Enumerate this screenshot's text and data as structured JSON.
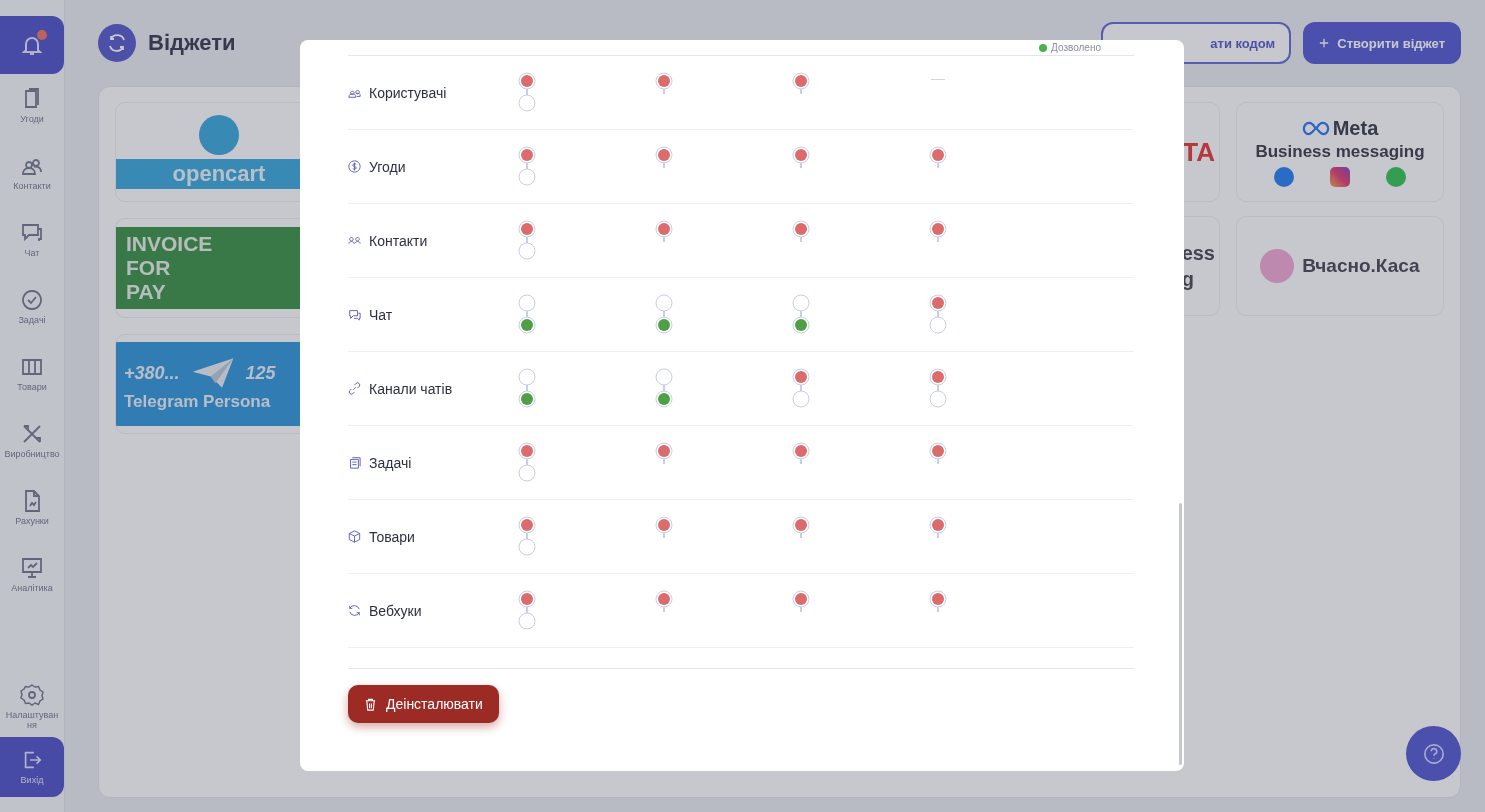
{
  "sidebar": {
    "items": [
      {
        "label": "Угоди"
      },
      {
        "label": "Контакти"
      },
      {
        "label": "Чат"
      },
      {
        "label": "Задачі"
      },
      {
        "label": "Товари"
      },
      {
        "label": "Виробництво"
      },
      {
        "label": "Рахунки"
      },
      {
        "label": "Аналітика"
      }
    ],
    "settings": "Налаштування",
    "logout": "Вихід"
  },
  "header": {
    "title": "Віджети",
    "code_button": "ати кодом",
    "create_button": "Створити віджет"
  },
  "widgets_left": [
    {
      "kind": "opencart",
      "texts": [
        "opencart"
      ]
    },
    {
      "kind": "invoice",
      "texts": [
        "INVOICE",
        "FOR",
        "PAY"
      ]
    },
    {
      "kind": "telegram",
      "texts": [
        "+380...",
        "125",
        "Telegram Persona"
      ]
    }
  ],
  "widgets_right": [
    {
      "kind": "partial_red",
      "texts": [
        "TA"
      ]
    },
    {
      "kind": "partial_dark",
      "texts": [
        "ess",
        "g"
      ]
    },
    {
      "kind": "meta",
      "texts": [
        "Meta",
        "Business messaging"
      ]
    },
    {
      "kind": "vchasno",
      "texts": [
        "Вчасно.Каса"
      ]
    }
  ],
  "modal": {
    "legend": "Дозволено",
    "rows": [
      {
        "label": "Користувачі",
        "cells": [
          {
            "kind": "toggle",
            "allowed": false,
            "expanded": true
          },
          {
            "kind": "toggle",
            "allowed": false,
            "expanded": false
          },
          {
            "kind": "toggle",
            "allowed": false,
            "expanded": false
          },
          {
            "kind": "none"
          }
        ]
      },
      {
        "label": "Угоди",
        "cells": [
          {
            "kind": "toggle",
            "allowed": false,
            "expanded": true
          },
          {
            "kind": "toggle",
            "allowed": false,
            "expanded": false
          },
          {
            "kind": "toggle",
            "allowed": false,
            "expanded": false
          },
          {
            "kind": "toggle",
            "allowed": false,
            "expanded": false
          }
        ]
      },
      {
        "label": "Контакти",
        "cells": [
          {
            "kind": "toggle",
            "allowed": false,
            "expanded": true
          },
          {
            "kind": "toggle",
            "allowed": false,
            "expanded": false
          },
          {
            "kind": "toggle",
            "allowed": false,
            "expanded": false
          },
          {
            "kind": "toggle",
            "allowed": false,
            "expanded": false
          }
        ]
      },
      {
        "label": "Чат",
        "cells": [
          {
            "kind": "toggle",
            "allowed": true,
            "expanded": true
          },
          {
            "kind": "toggle",
            "allowed": true,
            "expanded": true
          },
          {
            "kind": "toggle",
            "allowed": true,
            "expanded": true
          },
          {
            "kind": "toggle",
            "allowed": false,
            "expanded": true
          }
        ]
      },
      {
        "label": "Канали чатів",
        "cells": [
          {
            "kind": "toggle",
            "allowed": true,
            "expanded": true
          },
          {
            "kind": "toggle",
            "allowed": true,
            "expanded": true
          },
          {
            "kind": "toggle",
            "allowed": false,
            "expanded": true
          },
          {
            "kind": "toggle",
            "allowed": false,
            "expanded": true
          }
        ]
      },
      {
        "label": "Задачі",
        "cells": [
          {
            "kind": "toggle",
            "allowed": false,
            "expanded": true
          },
          {
            "kind": "toggle",
            "allowed": false,
            "expanded": false
          },
          {
            "kind": "toggle",
            "allowed": false,
            "expanded": false
          },
          {
            "kind": "toggle",
            "allowed": false,
            "expanded": false
          }
        ]
      },
      {
        "label": "Товари",
        "cells": [
          {
            "kind": "toggle",
            "allowed": false,
            "expanded": true
          },
          {
            "kind": "toggle",
            "allowed": false,
            "expanded": false
          },
          {
            "kind": "toggle",
            "allowed": false,
            "expanded": false
          },
          {
            "kind": "toggle",
            "allowed": false,
            "expanded": false
          }
        ]
      },
      {
        "label": "Вебхуки",
        "cells": [
          {
            "kind": "toggle",
            "allowed": false,
            "expanded": true
          },
          {
            "kind": "toggle",
            "allowed": false,
            "expanded": false
          },
          {
            "kind": "toggle",
            "allowed": false,
            "expanded": false
          },
          {
            "kind": "toggle",
            "allowed": false,
            "expanded": false
          }
        ]
      }
    ],
    "uninstall_button": "Деінсталювати"
  }
}
